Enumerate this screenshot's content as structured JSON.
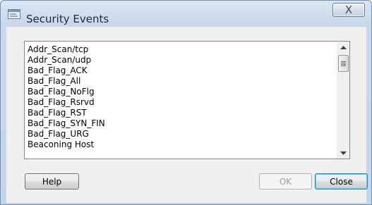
{
  "window": {
    "title": "Security Events",
    "close_glyph": "X",
    "icon": "app-window-icon"
  },
  "list": {
    "items": [
      "Addr_Scan/tcp",
      "Addr_Scan/udp",
      "Bad_Flag_ACK",
      "Bad_Flag_All",
      "Bad_Flag_NoFlg",
      "Bad_Flag_Rsrvd",
      "Bad_Flag_RST",
      "Bad_Flag_SYN_FIN",
      "Bad_Flag_URG",
      "Beaconing Host"
    ],
    "scroll": {
      "up_icon": "scroll-up-arrow-icon",
      "down_icon": "scroll-down-arrow-icon"
    }
  },
  "buttons": {
    "help": "Help",
    "ok": "OK",
    "close": "Close"
  },
  "colors": {
    "title_bar": "#c9d8ea",
    "client_bg": "#f0f0f0",
    "default_button_border": "#3c7fb1"
  }
}
